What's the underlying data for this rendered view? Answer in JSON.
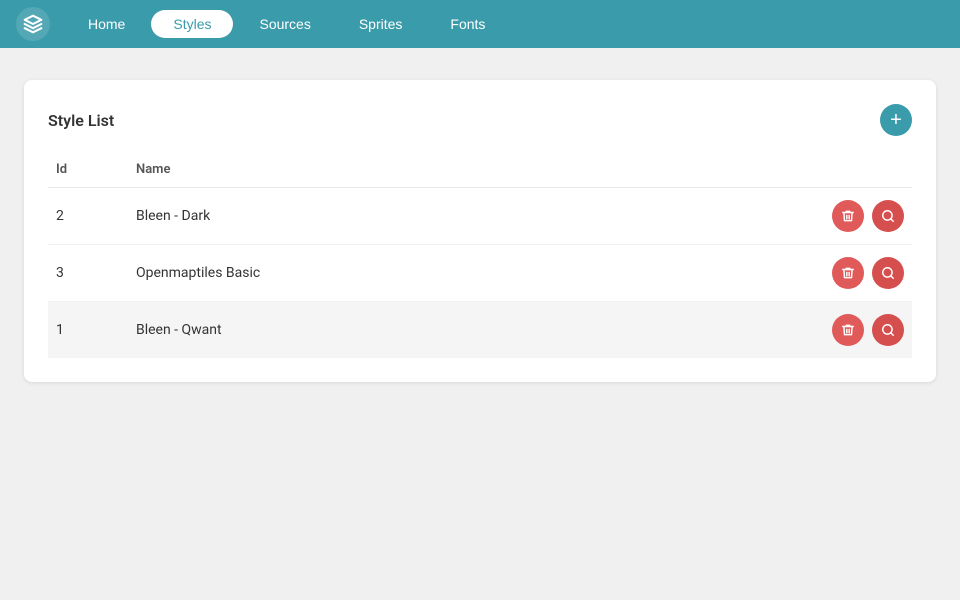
{
  "header": {
    "tabs": [
      {
        "id": "home",
        "label": "Home",
        "active": false
      },
      {
        "id": "styles",
        "label": "Styles",
        "active": true
      },
      {
        "id": "sources",
        "label": "Sources",
        "active": false
      },
      {
        "id": "sprites",
        "label": "Sprites",
        "active": false
      },
      {
        "id": "fonts",
        "label": "Fonts",
        "active": false
      }
    ]
  },
  "card": {
    "title": "Style List",
    "add_label": "+",
    "table": {
      "columns": [
        {
          "key": "id",
          "label": "Id"
        },
        {
          "key": "name",
          "label": "Name"
        }
      ],
      "rows": [
        {
          "id": "2",
          "name": "Bleen - Dark"
        },
        {
          "id": "3",
          "name": "Openmaptiles Basic"
        },
        {
          "id": "1",
          "name": "Bleen - Qwant"
        }
      ]
    }
  }
}
